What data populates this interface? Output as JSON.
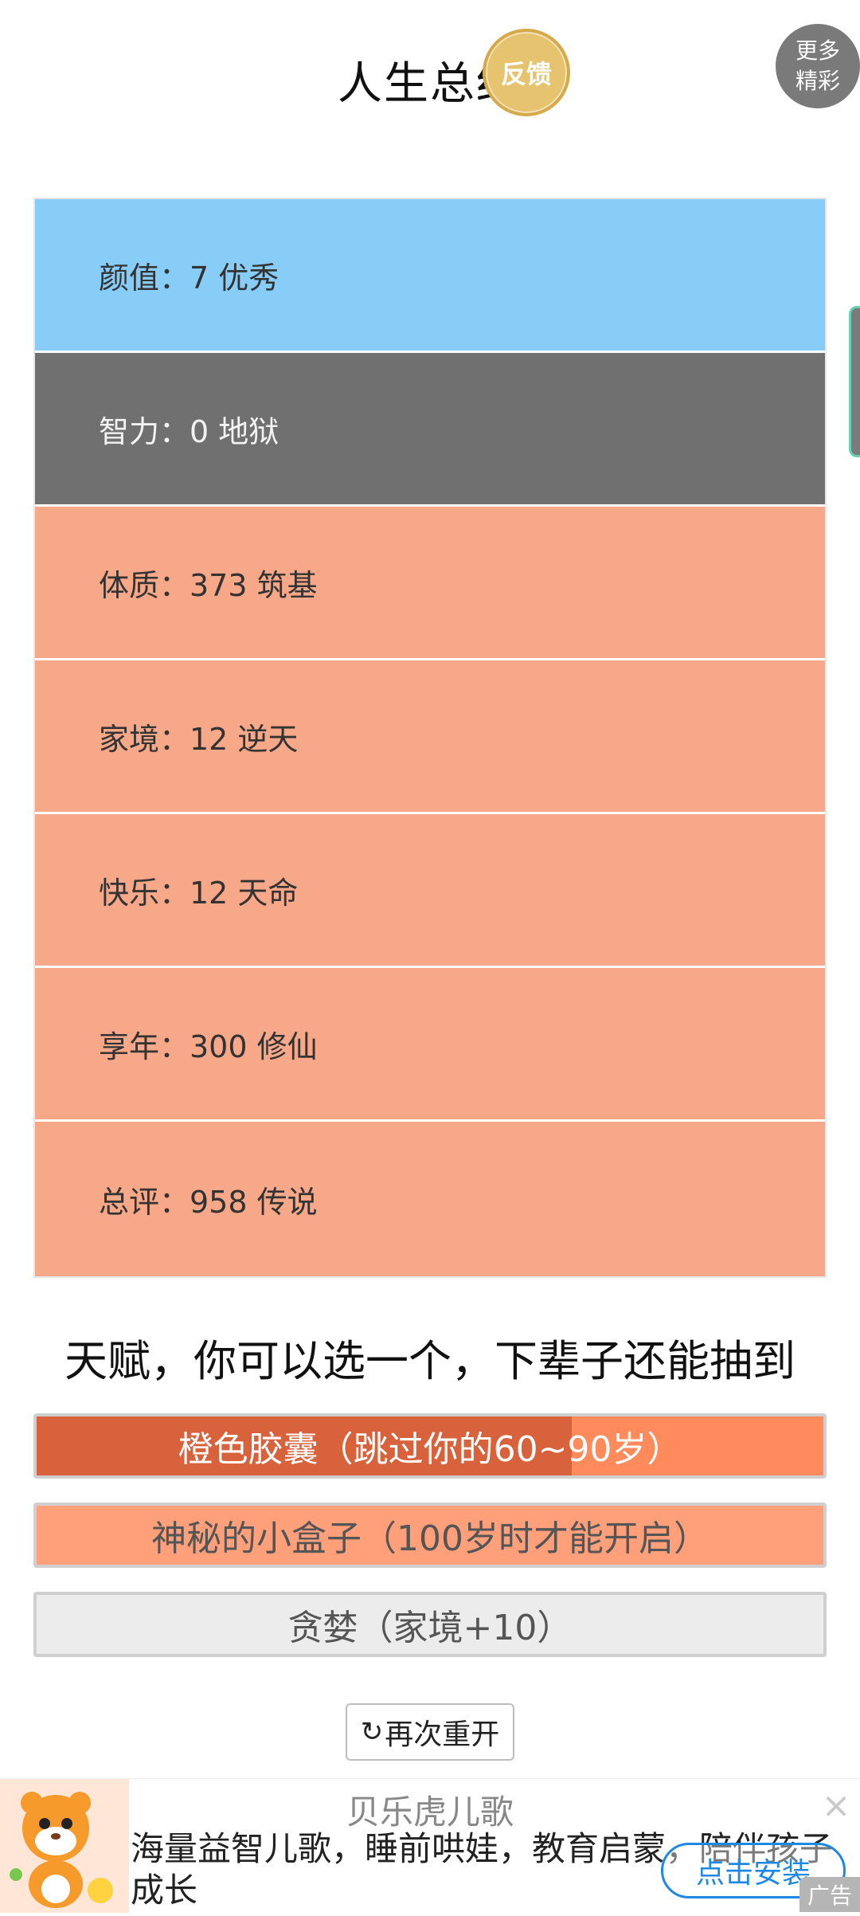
{
  "header": {
    "title": "人生总结",
    "feedback_label": "反馈",
    "more_label_line1": "更多",
    "more_label_line2": "精彩"
  },
  "stats": [
    {
      "label": "颜值：7 优秀",
      "color": "#87cdf8",
      "light_text": false
    },
    {
      "label": "智力：0 地狱",
      "color": "#707070",
      "light_text": true
    },
    {
      "label": "体质：373 筑基",
      "color": "#f7a888",
      "light_text": false
    },
    {
      "label": "家境：12 逆天",
      "color": "#f7a888",
      "light_text": false
    },
    {
      "label": "快乐：12 天命",
      "color": "#f7a888",
      "light_text": false
    },
    {
      "label": "享年：300 修仙",
      "color": "#f7a888",
      "light_text": false
    },
    {
      "label": "总评：958 传说",
      "color": "#f7a888",
      "light_text": false
    }
  ],
  "talents": {
    "title": "天赋，你可以选一个，下辈子还能抽到",
    "items": [
      {
        "label": "橙色胶囊（跳过你的60~90岁）",
        "bg": "#ff8a5b",
        "fill": "#d8623c",
        "fill_fraction": 0.68,
        "text_color": "#ffffff"
      },
      {
        "label": "神秘的小盒子（100岁时才能开启）",
        "bg": "#ffa07a",
        "fill": "#ffa07a",
        "fill_fraction": 0,
        "text_color": "#555555"
      },
      {
        "label": "贪婪（家境+10）",
        "bg": "#ececec",
        "fill": "#ececec",
        "fill_fraction": 0,
        "text_color": "#555555"
      }
    ]
  },
  "restart": {
    "icon": "refresh-icon",
    "label": "再次重开"
  },
  "ad": {
    "title": "贝乐虎儿歌",
    "desc": "海量益智儿歌，睡前哄娃，教育启蒙，陪伴孩子成长",
    "cta": "点击安装",
    "tag": "广告",
    "close": "×"
  }
}
